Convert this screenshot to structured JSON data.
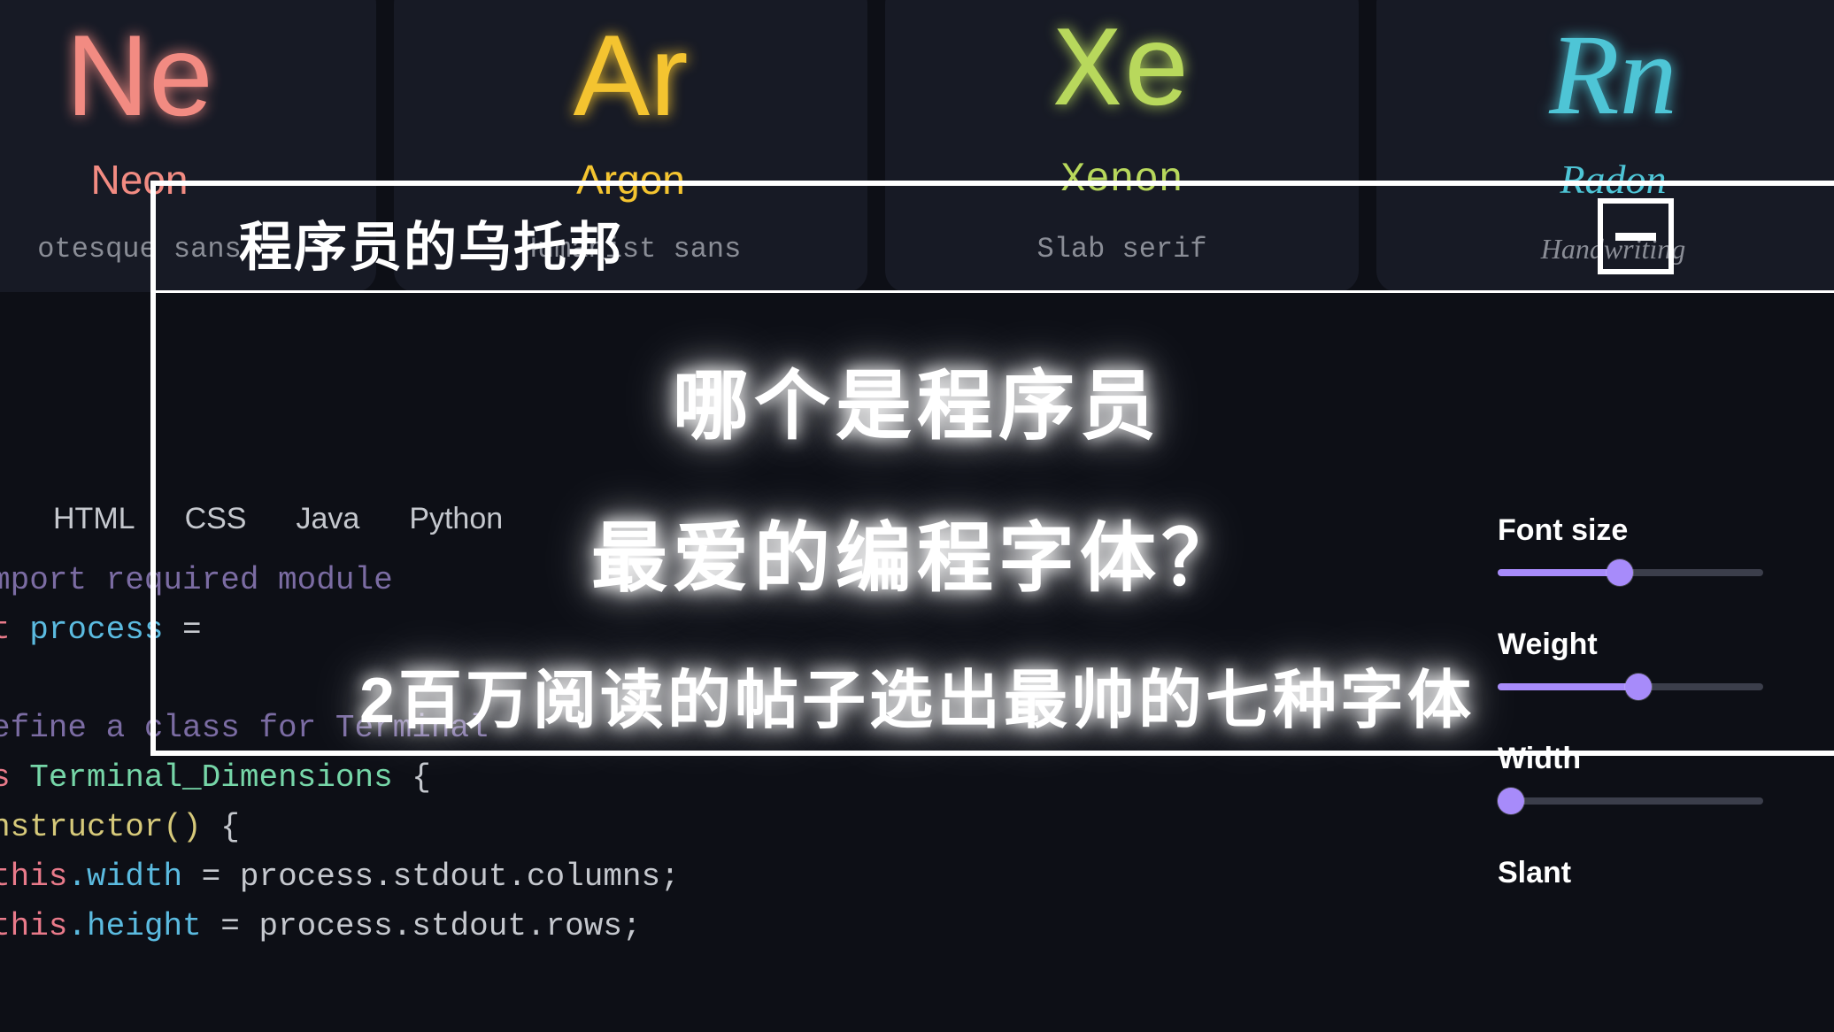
{
  "font_cards": {
    "neon": {
      "symbol": "Ne",
      "name": "Neon",
      "style": "otesque sans"
    },
    "argon": {
      "symbol": "Ar",
      "name": "Argon",
      "style": "Humanist sans"
    },
    "xenon": {
      "symbol": "Xe",
      "name": "Xenon",
      "style": "Slab serif"
    },
    "radon": {
      "symbol": "Rn",
      "name": "Radon",
      "style": "Handwriting"
    }
  },
  "tabs": {
    "html": "HTML",
    "css": "CSS",
    "java": "Java",
    "python": "Python"
  },
  "code": {
    "comment1": "mport required module",
    "kw_const": "t",
    "ident_process": "process",
    "eq": " = ",
    "comment2": "efine a class for Terminal",
    "kw_class": "s",
    "class_name": "Terminal_Dimensions",
    "brace_open": " {",
    "ctor": "nstructor()",
    "ctor_brace": " {",
    "this": "this",
    "dot_width": ".width",
    "assign1_rhs": " = process.stdout.columns;",
    "dot_height": ".height",
    "assign2_rhs": " = process.stdout.rows;"
  },
  "controls": {
    "font_size": {
      "label": "Font size",
      "percent": 46
    },
    "weight": {
      "label": "Weight",
      "percent": 53
    },
    "width": {
      "label": "Width",
      "percent": 5
    },
    "slant": {
      "label": "Slant"
    }
  },
  "overlay": {
    "brand": "程序员的乌托邦",
    "headline_1": "哪个是程序员",
    "headline_2": "最爱的编程字体？",
    "headline_3": "2百万阅读的帖子选出最帅的七种字体"
  }
}
